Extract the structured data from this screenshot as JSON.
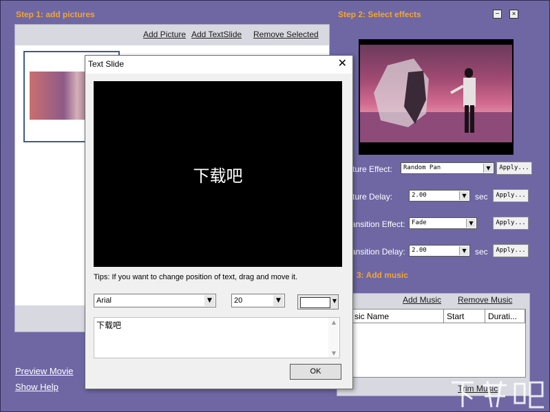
{
  "step1": {
    "title": "Step 1: add pictures",
    "add_picture": "Add Picture",
    "add_textslide": "Add TextSlide",
    "remove_selected": "Remove Selected"
  },
  "step2": {
    "title": "Step 2: Select effects",
    "picture_effect_label": "ture Effect:",
    "picture_effect_value": "Random Pan",
    "picture_delay_label": "ture Delay:",
    "picture_delay_value": "2.00",
    "transition_effect_label": "ansition Effect:",
    "transition_effect_value": "Fade",
    "transition_delay_label": "ansition Delay:",
    "transition_delay_value": "2.00",
    "apply_label": "Apply...",
    "sec_label": "sec"
  },
  "step3": {
    "title": "3: Add music",
    "add_music": "Add Music",
    "remove_music": "Remove Music",
    "columns": [
      "sic Name",
      "Start",
      "Durati..."
    ],
    "trim_music": "Trim Music"
  },
  "bottom_links": {
    "preview_movie": "Preview Movie",
    "show_help": "Show Help"
  },
  "window_buttons": {
    "minimize": "−",
    "close": "×"
  },
  "dialog": {
    "title": "Text Slide",
    "close_glyph": "✕",
    "canvas_text": "下载吧",
    "tips": "Tips: If you want to change position of text, drag and move it.",
    "font_value": "Arial",
    "size_value": "20",
    "text_value": "下载吧",
    "ok_label": "OK",
    "text_color": "#ffffff"
  },
  "colors": {
    "background": "#6e67a4",
    "step_title": "#f3a533"
  }
}
